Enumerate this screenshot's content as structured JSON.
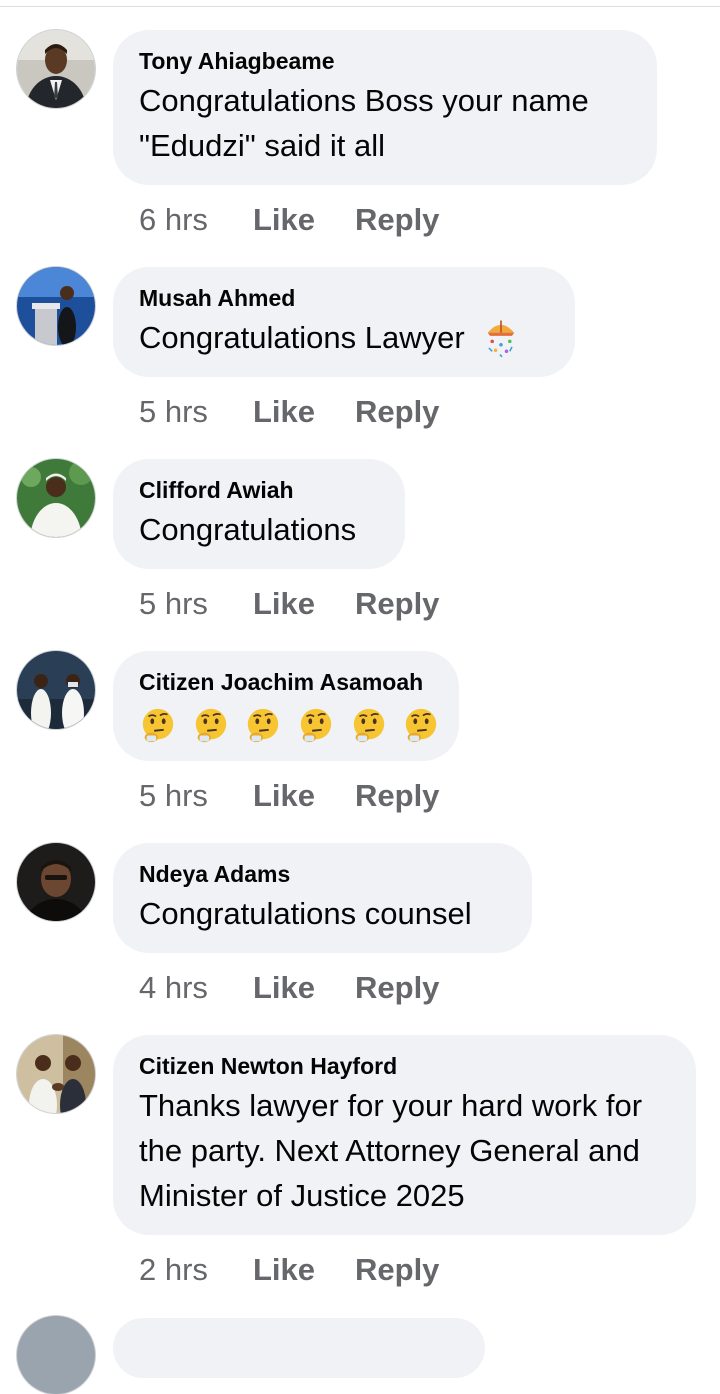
{
  "colors": {
    "bubble": "#f0f2f5",
    "text": "#050505",
    "meta": "#65676b"
  },
  "action_labels": {
    "like": "Like",
    "reply": "Reply"
  },
  "comments": [
    {
      "author": "Tony Ahiagbeame",
      "text": "Congratulations Boss your name \"Edudzi\" said it all",
      "time": "6 hrs",
      "avatar_icon": "man-in-suit-avatar"
    },
    {
      "author": "Musah Ahmed",
      "text": "Congratulations Lawyer",
      "emoji": "party-popper-emoji",
      "time": "5 hrs",
      "avatar_icon": "speaker-at-podium-avatar"
    },
    {
      "author": "Clifford Awiah",
      "text": "Congratulations",
      "time": "5 hrs",
      "avatar_icon": "man-in-white-robe-avatar"
    },
    {
      "author": "Citizen Joachim Asamoah",
      "emoji": "thinking-face-emoji",
      "emoji_count": 6,
      "time": "5 hrs",
      "avatar_icon": "people-in-white-avatar"
    },
    {
      "author": "Ndeya Adams",
      "text": "Congratulations counsel",
      "time": "4 hrs",
      "avatar_icon": "man-portrait-avatar"
    },
    {
      "author": "Citizen Newton Hayford",
      "text": "Thanks lawyer for your hard work for the party. Next Attorney General and Minister of Justice 2025",
      "time": "2 hrs",
      "avatar_icon": "handshake-avatar"
    }
  ]
}
